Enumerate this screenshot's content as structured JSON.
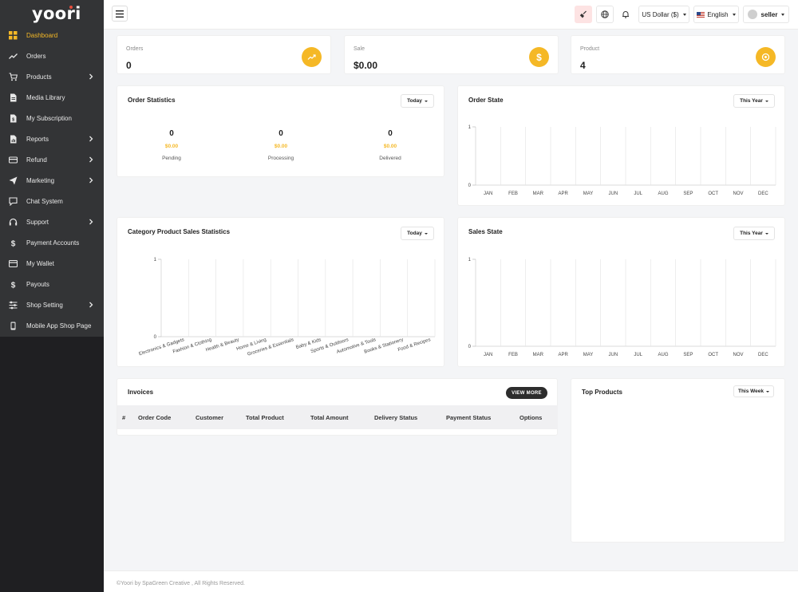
{
  "app": {
    "logo": "yoori"
  },
  "sidebar": {
    "items": [
      {
        "label": "Dashboard",
        "icon": "dashboard-icon",
        "active": true,
        "has_children": false
      },
      {
        "label": "Orders",
        "icon": "trending-up-icon",
        "active": false,
        "has_children": false
      },
      {
        "label": "Products",
        "icon": "cart-icon",
        "active": false,
        "has_children": true
      },
      {
        "label": "Media Library",
        "icon": "file-icon",
        "active": false,
        "has_children": false
      },
      {
        "label": "My Subscription",
        "icon": "subscription-icon",
        "active": false,
        "has_children": false
      },
      {
        "label": "Reports",
        "icon": "report-icon",
        "active": false,
        "has_children": true
      },
      {
        "label": "Refund",
        "icon": "refund-icon",
        "active": false,
        "has_children": true
      },
      {
        "label": "Marketing",
        "icon": "send-icon",
        "active": false,
        "has_children": true
      },
      {
        "label": "Chat System",
        "icon": "chat-icon",
        "active": false,
        "has_children": false
      },
      {
        "label": "Support",
        "icon": "headset-icon",
        "active": false,
        "has_children": true
      },
      {
        "label": "Payment Accounts",
        "icon": "dollar-icon",
        "active": false,
        "has_children": false
      },
      {
        "label": "My Wallet",
        "icon": "wallet-icon",
        "active": false,
        "has_children": false
      },
      {
        "label": "Payouts",
        "icon": "dollar-icon",
        "active": false,
        "has_children": false
      },
      {
        "label": "Shop Setting",
        "icon": "sliders-icon",
        "active": false,
        "has_children": true
      },
      {
        "label": "Mobile App Shop Page",
        "icon": "mobile-icon",
        "active": false,
        "has_children": false
      }
    ]
  },
  "topbar": {
    "currency": "US Dollar ($)",
    "language": "English",
    "user": "seller"
  },
  "stats": [
    {
      "label": "Orders",
      "value": "0",
      "icon": "trending-up-icon"
    },
    {
      "label": "Sale",
      "value": "$0.00",
      "icon": "dollar-icon"
    },
    {
      "label": "Product",
      "value": "4",
      "icon": "package-icon"
    }
  ],
  "order_statistics": {
    "title": "Order Statistics",
    "filter": "Today",
    "columns": [
      {
        "count": "0",
        "amount": "$0.00",
        "label": "Pending"
      },
      {
        "count": "0",
        "amount": "$0.00",
        "label": "Processing"
      },
      {
        "count": "0",
        "amount": "$0.00",
        "label": "Delivered"
      }
    ]
  },
  "order_state": {
    "title": "Order State",
    "filter": "This Year"
  },
  "category_sales": {
    "title": "Category Product Sales Statistics",
    "filter": "Today"
  },
  "sales_state": {
    "title": "Sales State",
    "filter": "This Year"
  },
  "invoices": {
    "title": "Invoices",
    "view_more": "VIEW MORE",
    "columns": [
      "#",
      "Order Code",
      "Customer",
      "Total Product",
      "Total Amount",
      "Delivery Status",
      "Payment Status",
      "Options"
    ]
  },
  "top_products": {
    "title": "Top Products",
    "filter": "This Week"
  },
  "footer": {
    "text": "©Yoori by SpaGreen Creative , All Rights Reserved."
  },
  "colors": {
    "accent": "#f5b826",
    "sidebar": "#333436",
    "sidebar_bottom": "#1f1f22"
  },
  "chart_data": [
    {
      "type": "bar",
      "title": "Order State",
      "categories": [
        "JAN",
        "FEB",
        "MAR",
        "APR",
        "MAY",
        "JUN",
        "JUL",
        "AUG",
        "SEP",
        "OCT",
        "NOV",
        "DEC"
      ],
      "values": [
        0,
        0,
        0,
        0,
        0,
        0,
        0,
        0,
        0,
        0,
        0,
        0
      ],
      "ylim": [
        0,
        1
      ],
      "yticks": [
        "0",
        "1"
      ],
      "grid": true
    },
    {
      "type": "bar",
      "title": "Category Product Sales Statistics",
      "categories": [
        "Electronics & Gadgets",
        "Fashion & Clothing",
        "Health & Beauty",
        "Home & Living",
        "Groceries & Essentials",
        "Baby & Kids",
        "Sports & Outdoors",
        "Automotive & Tools",
        "Books & Stationery",
        "Food & Recipes"
      ],
      "values": [
        0,
        0,
        0,
        0,
        0,
        0,
        0,
        0,
        0,
        0
      ],
      "ylim": [
        0,
        1
      ],
      "yticks": [
        "0",
        "1"
      ],
      "grid": true
    },
    {
      "type": "bar",
      "title": "Sales State",
      "categories": [
        "JAN",
        "FEB",
        "MAR",
        "APR",
        "MAY",
        "JUN",
        "JUL",
        "AUG",
        "SEP",
        "OCT",
        "NOV",
        "DEC"
      ],
      "values": [
        0,
        0,
        0,
        0,
        0,
        0,
        0,
        0,
        0,
        0,
        0,
        0
      ],
      "ylim": [
        0,
        1
      ],
      "yticks": [
        "0",
        "1"
      ],
      "grid": true
    }
  ]
}
